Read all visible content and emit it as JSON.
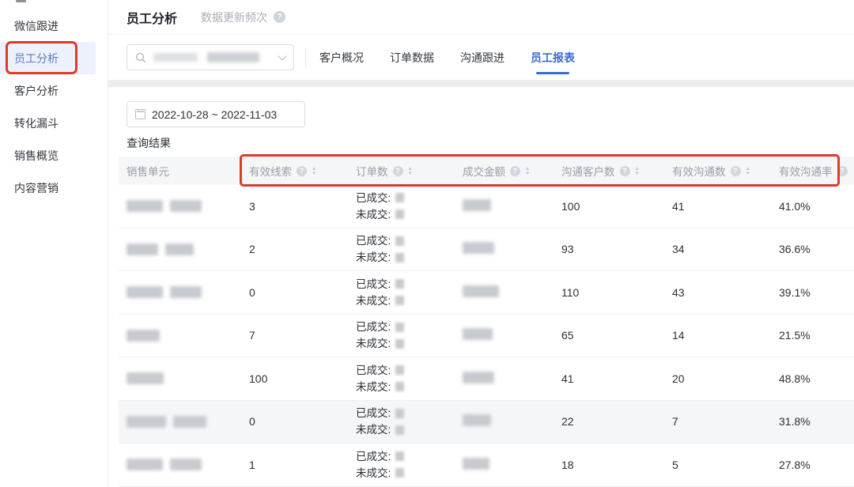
{
  "sidebar": {
    "items": [
      {
        "name": "sidebar-item-wechat-followup",
        "label": "微信跟进",
        "active": false
      },
      {
        "name": "sidebar-item-employee-analysis",
        "label": "员工分析",
        "active": true
      },
      {
        "name": "sidebar-item-customer-analysis",
        "label": "客户分析",
        "active": false
      },
      {
        "name": "sidebar-item-conversion-funnel",
        "label": "转化漏斗",
        "active": false
      },
      {
        "name": "sidebar-item-sales-overview",
        "label": "销售概览",
        "active": false
      },
      {
        "name": "sidebar-item-content-marketing",
        "label": "内容营销",
        "active": false
      }
    ]
  },
  "header": {
    "title": "员工分析",
    "subtitle": "数据更新频次",
    "help_icon": "question-circle-icon"
  },
  "filter": {
    "search": {
      "redacted": true,
      "icons": [
        "search-icon",
        "chevron-down-icon"
      ]
    },
    "tabs": [
      {
        "name": "tab-customer-overview",
        "label": "客户概况",
        "active": false
      },
      {
        "name": "tab-order-data",
        "label": "订单数据",
        "active": false
      },
      {
        "name": "tab-communication-followup",
        "label": "沟通跟进",
        "active": false
      },
      {
        "name": "tab-employee-report",
        "label": "员工报表",
        "active": true
      }
    ]
  },
  "toolbar": {
    "date_range": "2022-10-28 ~ 2022-11-03",
    "result_label": "查询结果"
  },
  "table": {
    "columns": [
      {
        "name": "col-sales-unit",
        "label": "销售单元",
        "help": false,
        "sort": false
      },
      {
        "name": "col-valid-leads",
        "label": "有效线索",
        "help": true,
        "sort": true
      },
      {
        "name": "col-order-count",
        "label": "订单数",
        "help": true,
        "sort": true
      },
      {
        "name": "col-deal-amount",
        "label": "成交金额",
        "help": true,
        "sort": true
      },
      {
        "name": "col-comm-customer-count",
        "label": "沟通客户数",
        "help": true,
        "sort": true
      },
      {
        "name": "col-valid-comm-count",
        "label": "有效沟通数",
        "help": true,
        "sort": true
      },
      {
        "name": "col-valid-comm-rate",
        "label": "有效沟通率",
        "help": true,
        "sort": false
      }
    ],
    "order_row_labels": {
      "closed": "已成交:",
      "not_closed": "未成交:"
    },
    "rows": [
      {
        "sales_unit_redacted": true,
        "valid_leads": "3",
        "order_counts_redacted": true,
        "amount_redacted": true,
        "comm_customers": "100",
        "valid_comms": "41",
        "valid_comm_rate": "41.0%",
        "highlight": false
      },
      {
        "sales_unit_redacted": true,
        "valid_leads": "2",
        "order_counts_redacted": true,
        "amount_redacted": true,
        "comm_customers": "93",
        "valid_comms": "34",
        "valid_comm_rate": "36.6%",
        "highlight": false
      },
      {
        "sales_unit_redacted": true,
        "valid_leads": "0",
        "order_counts_redacted": true,
        "amount_redacted": true,
        "comm_customers": "110",
        "valid_comms": "43",
        "valid_comm_rate": "39.1%",
        "highlight": false
      },
      {
        "sales_unit_redacted": true,
        "valid_leads": "7",
        "order_counts_redacted": true,
        "amount_redacted": true,
        "comm_customers": "65",
        "valid_comms": "14",
        "valid_comm_rate": "21.5%",
        "highlight": false
      },
      {
        "sales_unit_redacted": true,
        "valid_leads": "100",
        "order_counts_redacted": true,
        "amount_redacted": true,
        "comm_customers": "41",
        "valid_comms": "20",
        "valid_comm_rate": "48.8%",
        "highlight": false
      },
      {
        "sales_unit_redacted": true,
        "valid_leads": "0",
        "order_counts_redacted": true,
        "amount_redacted": true,
        "comm_customers": "22",
        "valid_comms": "7",
        "valid_comm_rate": "31.8%",
        "highlight": true
      },
      {
        "sales_unit_redacted": true,
        "valid_leads": "1",
        "order_counts_redacted": true,
        "amount_redacted": true,
        "comm_customers": "18",
        "valid_comms": "5",
        "valid_comm_rate": "27.8%",
        "highlight": false
      }
    ]
  },
  "annotations": {
    "red_boxes": [
      "sidebar-item-employee-analysis",
      "table-header-columns"
    ]
  },
  "colors": {
    "accent_blue": "#3a6ad4",
    "annotation_red": "#dc3b2c",
    "sidebar_active_bg": "#edf1fb",
    "sidebar_active_text": "#5a7ac6",
    "table_header_bg": "#f5f6f8"
  }
}
